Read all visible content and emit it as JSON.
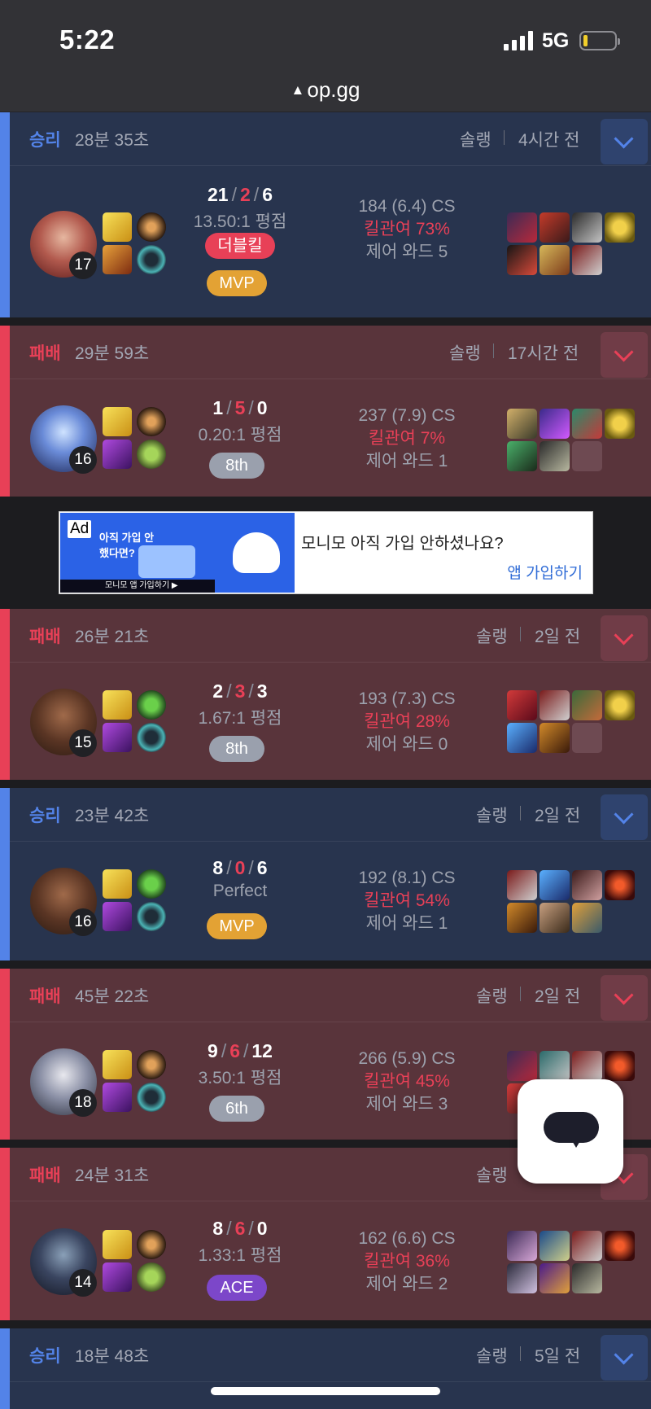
{
  "status_bar": {
    "time": "5:22",
    "network": "5G"
  },
  "browser": {
    "url": "op.gg"
  },
  "colors": {
    "win": "#5383e8",
    "loss": "#e84057",
    "win_bg": "#28344e",
    "loss_bg": "#59343b"
  },
  "matches": [
    {
      "result": "승리",
      "duration": "28분 35초",
      "queue": "솔랭",
      "time_ago": "4시간 전",
      "level": "17",
      "kills": "21",
      "deaths": "2",
      "assists": "6",
      "ratio": "13.50:1 평점",
      "badge": "더블킬",
      "badge2": "MVP",
      "cs": "184 (6.4) CS",
      "kill_participation": "킬관여 73%",
      "control_wards": "제어 와드 5"
    },
    {
      "result": "패배",
      "duration": "29분 59초",
      "queue": "솔랭",
      "time_ago": "17시간 전",
      "level": "16",
      "kills": "1",
      "deaths": "5",
      "assists": "0",
      "ratio": "0.20:1 평점",
      "badge": "8th",
      "cs": "237 (7.9) CS",
      "kill_participation": "킬관여 7%",
      "control_wards": "제어 와드 1"
    },
    {
      "result": "패배",
      "duration": "26분 21초",
      "queue": "솔랭",
      "time_ago": "2일 전",
      "level": "15",
      "kills": "2",
      "deaths": "3",
      "assists": "3",
      "ratio": "1.67:1 평점",
      "badge": "8th",
      "cs": "193 (7.3) CS",
      "kill_participation": "킬관여 28%",
      "control_wards": "제어 와드 0"
    },
    {
      "result": "승리",
      "duration": "23분 42초",
      "queue": "솔랭",
      "time_ago": "2일 전",
      "level": "16",
      "kills": "8",
      "deaths": "0",
      "assists": "6",
      "ratio": "Perfect",
      "badge": "MVP",
      "cs": "192 (8.1) CS",
      "kill_participation": "킬관여 54%",
      "control_wards": "제어 와드 1"
    },
    {
      "result": "패배",
      "duration": "45분 22초",
      "queue": "솔랭",
      "time_ago": "2일 전",
      "level": "18",
      "kills": "9",
      "deaths": "6",
      "assists": "12",
      "ratio": "3.50:1 평점",
      "badge": "6th",
      "cs": "266 (5.9) CS",
      "kill_participation": "킬관여 45%",
      "control_wards": "제어 와드 3"
    },
    {
      "result": "패배",
      "duration": "24분 31초",
      "queue": "솔랭",
      "level": "14",
      "kills": "8",
      "deaths": "6",
      "assists": "0",
      "ratio": "1.33:1 평점",
      "badge": "ACE",
      "cs": "162 (6.6) CS",
      "kill_participation": "킬관여 36%",
      "control_wards": "제어 와드 2"
    },
    {
      "result": "승리",
      "duration": "18분 48초",
      "queue": "솔랭",
      "time_ago": "5일 전"
    }
  ],
  "ad": {
    "tag": "Ad",
    "image_text": "아직 가입 안 했다면?",
    "image_strip": "모니모 앱 가입하기 ▶",
    "title": "모니모 아직 가입 안하셨나요?",
    "cta": "앱 가입하기"
  }
}
